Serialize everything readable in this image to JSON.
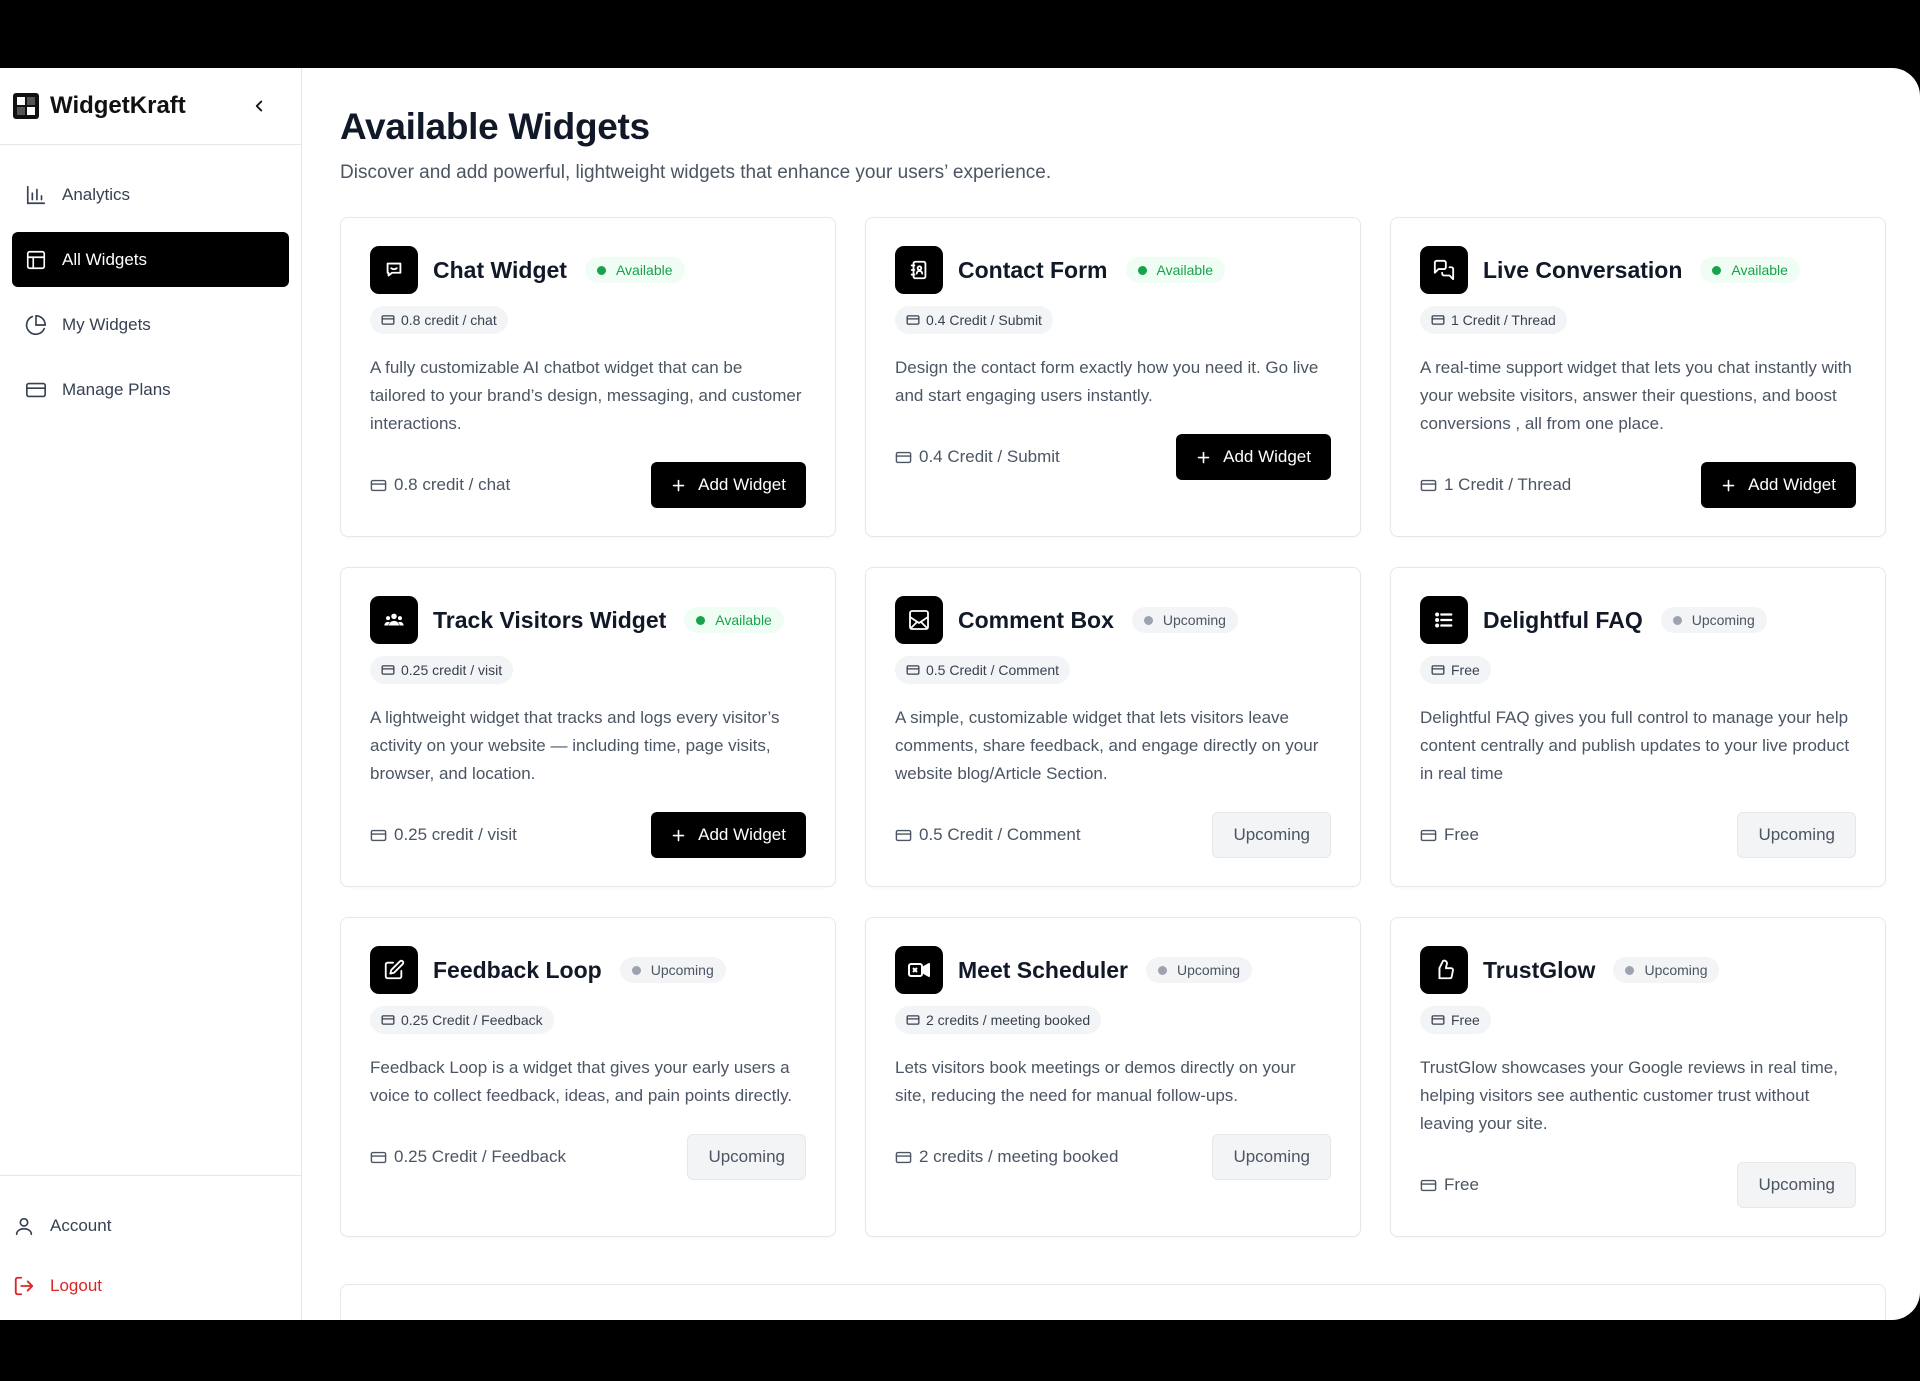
{
  "brand": {
    "name": "WidgetKraft"
  },
  "nav": [
    {
      "label": "Analytics",
      "icon": "bar-chart-icon",
      "active": false
    },
    {
      "label": "All Widgets",
      "icon": "layout-icon",
      "active": true
    },
    {
      "label": "My Widgets",
      "icon": "pie-chart-icon",
      "active": false
    },
    {
      "label": "Manage Plans",
      "icon": "credit-card-icon",
      "active": false
    }
  ],
  "bottom_nav": {
    "account": "Account",
    "logout": "Logout"
  },
  "page": {
    "title": "Available Widgets",
    "subtitle": "Discover and add powerful, lightweight widgets that enhance your users’ experience."
  },
  "buttons": {
    "add": "Add Widget",
    "upcoming": "Upcoming"
  },
  "widgets": [
    {
      "title": "Chat Widget",
      "status": "Available",
      "price": "0.8 credit / chat",
      "icon": "chat-icon",
      "description": "A fully customizable AI chatbot widget that can be tailored to your brand’s design, messaging, and customer interactions."
    },
    {
      "title": "Contact Form",
      "status": "Available",
      "price": "0.4 Credit / Submit",
      "icon": "contact-book-icon",
      "description": "Design the contact form exactly how you need it. Go live and start engaging users instantly."
    },
    {
      "title": "Live Conversation",
      "status": "Available",
      "price": "1 Credit / Thread",
      "icon": "conversation-icon",
      "description": "A real-time support widget that lets you chat instantly with your website visitors, answer their questions, and boost conversions , all from one place."
    },
    {
      "title": "Track Visitors Widget",
      "status": "Available",
      "price": "0.25 credit / visit",
      "icon": "users-icon",
      "description": "A lightweight widget that tracks and logs every visitor’s activity on your website — including time, page visits, browser, and location."
    },
    {
      "title": "Comment Box",
      "status": "Upcoming",
      "price": "0.5 Credit / Comment",
      "icon": "inbox-icon",
      "description": "A simple, customizable widget that lets visitors leave comments, share feedback, and engage directly on your website blog/Article Section."
    },
    {
      "title": "Delightful FAQ",
      "status": "Upcoming",
      "price": "Free",
      "icon": "list-icon",
      "description": "Delightful FAQ gives you full control to manage your help content centrally and publish updates to your live product in real time"
    },
    {
      "title": "Feedback Loop",
      "status": "Upcoming",
      "price": "0.25 Credit / Feedback",
      "icon": "edit-icon",
      "description": "Feedback Loop is a widget that gives your early users a voice to collect feedback, ideas, and pain points directly."
    },
    {
      "title": "Meet Scheduler",
      "status": "Upcoming",
      "price": "2 credits / meeting booked",
      "icon": "video-icon",
      "description": "Lets visitors book meetings or demos directly on your site, reducing the need for manual follow-ups."
    },
    {
      "title": "TrustGlow",
      "status": "Upcoming",
      "price": "Free",
      "icon": "thumbs-up-icon",
      "description": "TrustGlow showcases your Google reviews in real time, helping visitors see authentic customer trust without leaving your site."
    }
  ]
}
